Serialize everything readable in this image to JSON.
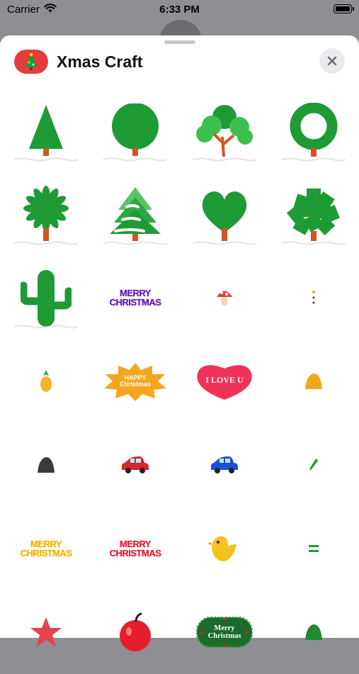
{
  "status_bar": {
    "carrier": "Carrier",
    "time": "6:33 PM"
  },
  "sheet": {
    "title": "Xmas Craft",
    "close_icon": "close-icon"
  },
  "stickers": [
    {
      "name": "sticker-pine-tree",
      "kind": "pine"
    },
    {
      "name": "sticker-round-tree",
      "kind": "round"
    },
    {
      "name": "sticker-bushy-tree",
      "kind": "bushy"
    },
    {
      "name": "sticker-wreath-tree",
      "kind": "ring"
    },
    {
      "name": "sticker-palm-tree",
      "kind": "palm"
    },
    {
      "name": "sticker-snowy-fir-tree",
      "kind": "fir"
    },
    {
      "name": "sticker-heart-tree",
      "kind": "hearttree"
    },
    {
      "name": "sticker-leafy-tree",
      "kind": "leafy"
    },
    {
      "name": "sticker-cactus",
      "kind": "cactus"
    },
    {
      "name": "sticker-merry-christmas-purple",
      "kind": "text",
      "lines": [
        "MERRY",
        "CHRISTMAS"
      ],
      "color": "#6a1fb0",
      "size": 13
    },
    {
      "name": "sticker-mushroom",
      "kind": "mushroom"
    },
    {
      "name": "sticker-tiny-dots",
      "kind": "dots"
    },
    {
      "name": "sticker-pineapple",
      "kind": "pineapple"
    },
    {
      "name": "sticker-happy-christmas-burst",
      "kind": "burst",
      "lines": [
        "HAPPY",
        "Christmas"
      ]
    },
    {
      "name": "sticker-i-love-u-heart",
      "kind": "heartlabel",
      "text": "I LOVE U"
    },
    {
      "name": "sticker-orange-hat",
      "kind": "hat",
      "color": "#f2a818"
    },
    {
      "name": "sticker-dark-hat",
      "kind": "hat",
      "color": "#3a3a3c"
    },
    {
      "name": "sticker-red-car",
      "kind": "car",
      "color": "#d6252b"
    },
    {
      "name": "sticker-blue-car",
      "kind": "car",
      "color": "#1d4fd6"
    },
    {
      "name": "sticker-green-pencil",
      "kind": "pencil"
    },
    {
      "name": "sticker-merry-christmas-yellow",
      "kind": "text",
      "lines": [
        "MERRY",
        "CHRISTMAS"
      ],
      "color": "#f5b400",
      "size": 13
    },
    {
      "name": "sticker-merry-christmas-red",
      "kind": "text",
      "lines": [
        "MERRY",
        "CHRISTMAS"
      ],
      "color": "#e3233a",
      "size": 13
    },
    {
      "name": "sticker-yellow-bird",
      "kind": "bird"
    },
    {
      "name": "sticker-green-equals",
      "kind": "equals"
    },
    {
      "name": "sticker-red-star",
      "kind": "star"
    },
    {
      "name": "sticker-red-apple",
      "kind": "apple"
    },
    {
      "name": "sticker-merry-christmas-wreath",
      "kind": "wreathlabel",
      "lines": [
        "Merry",
        "Christmas"
      ]
    },
    {
      "name": "sticker-green-hat",
      "kind": "hat",
      "color": "#1f8a2e"
    }
  ],
  "colors": {
    "leaf": "#1e9b34",
    "leaf_light": "#3cc14e",
    "trunk": "#d4551e",
    "app_icon_bg": "#e63b3b"
  }
}
